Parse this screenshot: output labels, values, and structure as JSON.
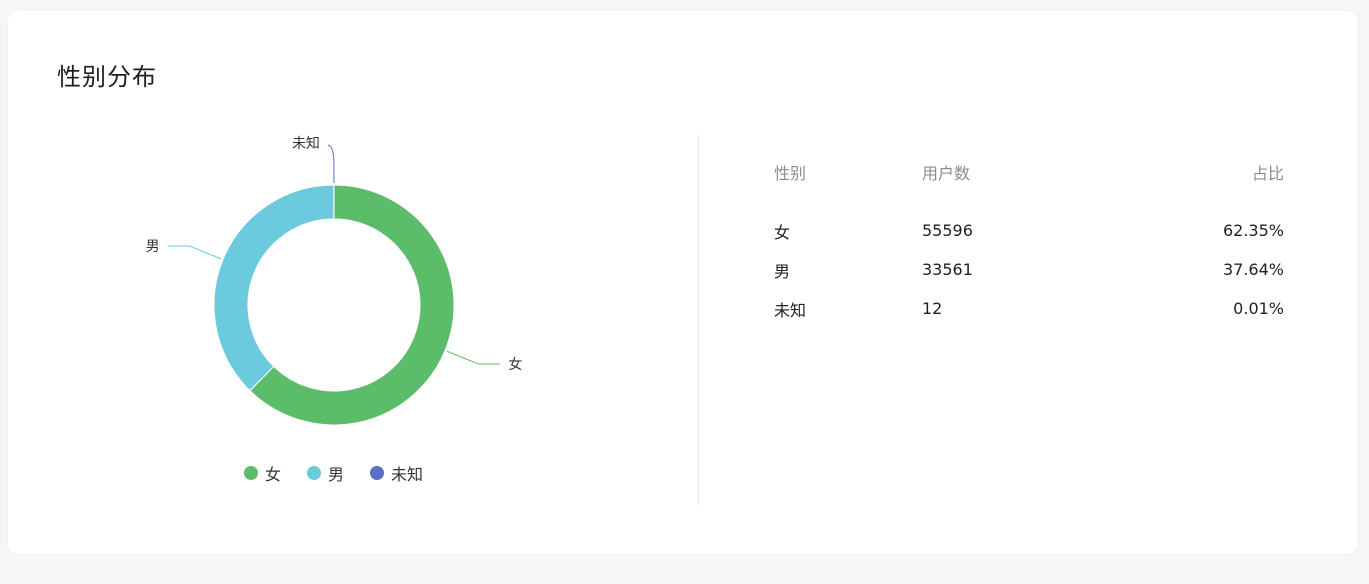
{
  "card": {
    "title": "性别分布"
  },
  "chart_data": {
    "type": "pie",
    "donut": true,
    "categories": [
      "女",
      "男",
      "未知"
    ],
    "values": [
      55596,
      33561,
      12
    ],
    "colors": [
      "#5bbd6a",
      "#6ccade",
      "#5b6ec8"
    ],
    "legend": "bottom"
  },
  "table": {
    "headers": [
      "性别",
      "用户数",
      "占比"
    ],
    "rows": [
      [
        "女",
        "55596",
        "62.35%"
      ],
      [
        "男",
        "33561",
        "37.64%"
      ],
      [
        "未知",
        "12",
        "0.01%"
      ]
    ]
  }
}
